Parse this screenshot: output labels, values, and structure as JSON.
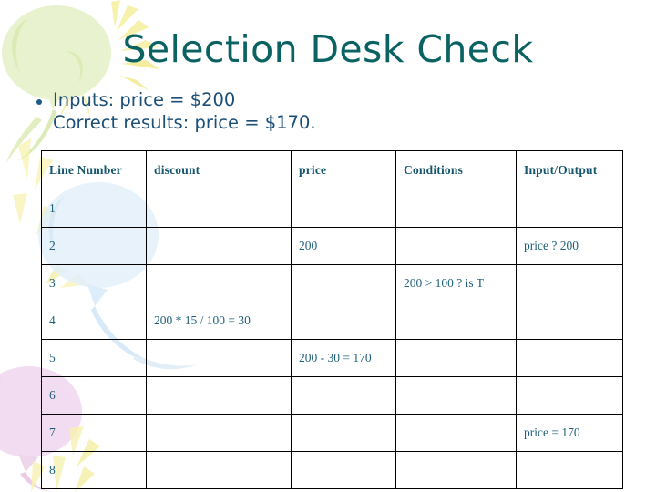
{
  "slide": {
    "title": "Selection Desk Check",
    "bullet": {
      "line1": "Inputs: price = $200",
      "line2": "Correct results: price = $170."
    }
  },
  "colors": {
    "title": "#0b6262",
    "body_text": "#1b4f77",
    "table_header_text": "#14566d",
    "table_cell_text": "#1f5f7a",
    "table_border": "#000000",
    "background": "#ffffff",
    "decor_green": "#e4f0c9",
    "decor_yellow": "#f7f0a8",
    "decor_blue": "#dcecf8",
    "decor_pink": "#f0daf0"
  },
  "table": {
    "headers": [
      "Line Number",
      "discount",
      "price",
      "Conditions",
      "Input/Output"
    ],
    "rows": [
      {
        "line": "1",
        "discount": "",
        "price": "",
        "conditions": "",
        "io": ""
      },
      {
        "line": "2",
        "discount": "",
        "price": "200",
        "conditions": "",
        "io": "price ? 200"
      },
      {
        "line": "3",
        "discount": "",
        "price": "",
        "conditions": "200 > 100 ? is T",
        "io": ""
      },
      {
        "line": "4",
        "discount": "200 * 15 / 100 = 30",
        "price": "",
        "conditions": "",
        "io": ""
      },
      {
        "line": "5",
        "discount": "",
        "price": "200 - 30 = 170",
        "conditions": "",
        "io": ""
      },
      {
        "line": "6",
        "discount": "",
        "price": "",
        "conditions": "",
        "io": ""
      },
      {
        "line": "7",
        "discount": "",
        "price": "",
        "conditions": "",
        "io": "price = 170"
      },
      {
        "line": "8",
        "discount": "",
        "price": "",
        "conditions": "",
        "io": ""
      }
    ]
  },
  "decor": {
    "balloon_green": "balloon-green-shape",
    "balloon_blue": "balloon-blue-shape",
    "balloon_pink": "balloon-pink-shape",
    "starburst": "starburst-rays-shape"
  }
}
